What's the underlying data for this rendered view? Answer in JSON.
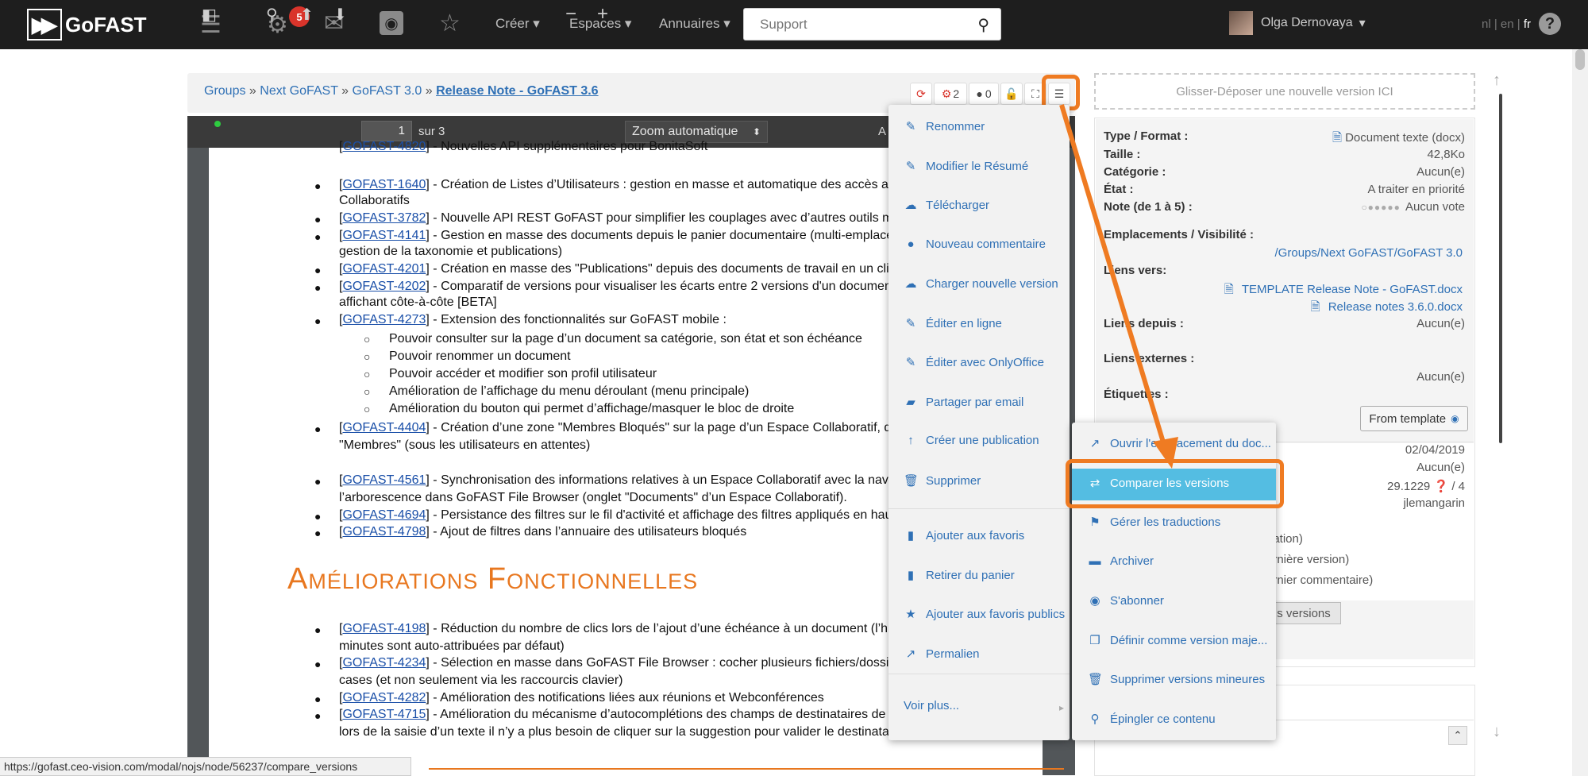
{
  "app": {
    "logo_text": "GoFAST",
    "notifications_count": "5",
    "menus": [
      "Créer",
      "Espaces",
      "Annuaires"
    ],
    "search_placeholder": "Support",
    "user_name": "Olga Dernovaya",
    "languages": [
      "nl",
      "en",
      "fr"
    ],
    "current_language": "fr"
  },
  "breadcrumb": {
    "items": [
      "Groups",
      "Next GoFAST",
      "GoFAST 3.0"
    ],
    "current": "Release Note - GoFAST 3.6",
    "separator": "»"
  },
  "toolbar": {
    "tasks_count": "2",
    "comments_count": "0"
  },
  "pdf_viewer": {
    "page_value": "1",
    "page_count_label": "sur 3",
    "zoom_label": "Zoom automatique",
    "truncated_label": "A"
  },
  "document": {
    "lines": [
      {
        "link": "GOFAST-4820",
        "text": " - Nouvelles API supplémentaires pour BonitaSoft",
        "bullet": false
      },
      {
        "link": "GOFAST-1640",
        "text": " - Création de Listes d’Utilisateurs : gestion en masse et automatique des accès aux",
        "bullet": true
      },
      {
        "link": "",
        "text": "Collaboratifs",
        "bullet": false
      },
      {
        "link": "GOFAST-3782",
        "text": " - Nouvelle API REST GoFAST pour simplifier les couplages avec d’autres outils mét",
        "bullet": true
      },
      {
        "link": "GOFAST-4141",
        "text": " - Gestion en masse des documents depuis le panier documentaire (multi-emplace",
        "bullet": true
      },
      {
        "link": "",
        "text": "gestion de la taxonomie et publications)",
        "bullet": false
      },
      {
        "link": "GOFAST-4201",
        "text": " - Création en masse des \"Publications\" depuis des documents de travail en un clic",
        "bullet": true
      },
      {
        "link": "GOFAST-4202",
        "text": " - Comparatif de versions pour visualiser les écarts entre 2 versions d'un documen",
        "bullet": true
      },
      {
        "link": "",
        "text": "affichant côte-à-côte [BETA]",
        "bullet": false
      },
      {
        "link": "GOFAST-4273",
        "text": " - Extension des fonctionnalités sur GoFAST mobile :",
        "bullet": true
      }
    ],
    "sub_items": [
      "Pouvoir consulter sur la page d’un document sa catégorie, son état et son échéance",
      "Pouvoir renommer un document",
      "Pouvoir accéder et modifier son profil utilisateur",
      "Amélioration de l’affichage du menu déroulant (menu principale)",
      "Amélioration du bouton qui permet d’affichage/masquer le bloc de droite"
    ],
    "lines2": [
      {
        "link": "GOFAST-4404",
        "text": " - Création d’une zone \"Membres Bloqués\" sur la page d’un Espace Collaboratif, d",
        "bullet": true
      },
      {
        "link": "",
        "text": "\"Membres\" (sous les utilisateurs en attentes)",
        "bullet": false
      },
      {
        "link": "GOFAST-4561",
        "text": " - Synchronisation des informations relatives à un Espace Collaboratif avec la navig",
        "bullet": true
      },
      {
        "link": "",
        "text": "l’arborescence dans GoFAST File Browser (onglet \"Documents\" d’un Espace Collaboratif).",
        "bullet": false
      },
      {
        "link": "GOFAST-4694",
        "text": " - Persistance des filtres sur le fil d'activité et affichage des filtres appliqués en hau",
        "bullet": true
      },
      {
        "link": "GOFAST-4798",
        "text": " - Ajout de filtres dans l’annuaire des utilisateurs bloqués",
        "bullet": true
      }
    ],
    "heading": "Améliorations Fonctionnelles",
    "lines3": [
      {
        "link": "GOFAST-4198",
        "text": " - Réduction du nombre de clics lors de l’ajout d’une échéance à un document (l’h",
        "bullet": true
      },
      {
        "link": "",
        "text": "minutes sont auto-attribuées par défaut)",
        "bullet": false
      },
      {
        "link": "GOFAST-4234",
        "text": " - Sélection en masse dans GoFAST File Browser : cocher plusieurs fichiers/dossier",
        "bullet": true
      },
      {
        "link": "",
        "text": "cases (et non seulement via les raccourcis clavier)",
        "bullet": false
      },
      {
        "link": "GOFAST-4282",
        "text": " - Amélioration des notifications liées aux réunions et Webconférences",
        "bullet": true
      },
      {
        "link": "GOFAST-4715",
        "text": " - Amélioration du mécanisme d’autocomplétions des champs de destinataires de",
        "bullet": true
      },
      {
        "link": "",
        "text": "lors de la saisie d’un texte il n’y a plus besoin de cliquer sur la suggestion pour valider le destinata",
        "bullet": false
      }
    ]
  },
  "right_panel": {
    "dropzone": "Glisser-Déposer une nouvelle version ICI",
    "type_label": "Type / Format :",
    "type_value": "Document texte (docx)",
    "size_label": "Taille :",
    "size_value": "42,8Ko",
    "category_label": "Catégorie :",
    "category_value": "Aucun(e)",
    "state_label": "État :",
    "state_value": "A traiter en priorité",
    "rating_label": "Note (de 1 à 5) :",
    "rating_value": "Aucun vote",
    "locations_label": "Emplacements / Visibilité :",
    "locations_value": "/Groups/Next GoFAST/GoFAST 3.0",
    "links_to_label": "Liens vers:",
    "links_to": [
      "TEMPLATE Release Note - GoFAST.docx",
      "Release notes 3.6.0.docx"
    ],
    "links_from_label": "Liens depuis :",
    "links_from_value": "Aucun(e)",
    "external_links_label": "Liens externes :",
    "external_links_value": "Aucun(e)",
    "tags_label": "Étiquettes :",
    "template_button": "From template",
    "date_value": "02/04/2019",
    "second_value": "Aucun(e)",
    "version_value": "29.1229",
    "version_of": "/ 4",
    "author_value": "jlemangarin",
    "hist1": "éation)",
    "hist2": "ernière version)",
    "hist3": "ernier commentaire)",
    "versions_btn": "s versions"
  },
  "actions_menu": {
    "items": [
      {
        "label": "Renommer",
        "icon": "pencil-icon",
        "glyph": "✎"
      },
      {
        "label": "Modifier le Résumé",
        "icon": "pencil-icon",
        "glyph": "✎"
      },
      {
        "label": "Télécharger",
        "icon": "cloud-download-icon",
        "glyph": "☁"
      },
      {
        "label": "Nouveau commentaire",
        "icon": "comment-icon",
        "glyph": "●"
      },
      {
        "label": "Charger nouvelle version",
        "icon": "cloud-upload-icon",
        "glyph": "☁"
      },
      {
        "label": "Éditer en ligne",
        "icon": "edit-icon",
        "glyph": "✎"
      },
      {
        "label": "Éditer avec OnlyOffice",
        "icon": "edit-icon",
        "glyph": "✎"
      },
      {
        "label": "Partager par email",
        "icon": "share-icon",
        "glyph": "▰"
      },
      {
        "label": "Créer une publication",
        "icon": "arrow-up-icon",
        "glyph": "↑"
      },
      {
        "label": "Supprimer",
        "icon": "trash-icon",
        "glyph": "🗑"
      },
      {
        "label": "Ajouter aux favoris",
        "icon": "bookmark-icon",
        "glyph": "▮"
      },
      {
        "label": "Retirer du panier",
        "icon": "bookmark-icon",
        "glyph": "▮"
      },
      {
        "label": "Ajouter aux favoris publics",
        "icon": "star-icon",
        "glyph": "★"
      },
      {
        "label": "Permalien",
        "icon": "external-link-icon",
        "glyph": "↗"
      },
      {
        "label": "Voir plus...",
        "icon": "",
        "glyph": ""
      }
    ]
  },
  "submenu": {
    "items": [
      {
        "label": "Ouvrir l'emplacement du doc...",
        "icon": "external-link-icon",
        "glyph": "↗"
      },
      {
        "label": "Comparer les versions",
        "icon": "exchange-icon",
        "glyph": "⇄"
      },
      {
        "label": "Gérer les traductions",
        "icon": "flag-icon",
        "glyph": "⚑"
      },
      {
        "label": "Archiver",
        "icon": "archive-icon",
        "glyph": "▬"
      },
      {
        "label": "S'abonner",
        "icon": "rss-icon",
        "glyph": "◉"
      },
      {
        "label": "Définir comme version maje...",
        "icon": "copy-icon",
        "glyph": "❐"
      },
      {
        "label": "Supprimer versions mineures",
        "icon": "trash-icon",
        "glyph": "🗑"
      },
      {
        "label": "Épingler ce contenu",
        "icon": "pin-icon",
        "glyph": "⚲"
      }
    ],
    "active_index": 1
  },
  "status_bar": "https://gofast.ceo-vision.com/modal/nojs/node/56237/compare_versions",
  "colors": {
    "highlight": "#ef7b22",
    "active_item": "#54bde2",
    "link": "#2f70b5",
    "heading": "#e8771f"
  }
}
